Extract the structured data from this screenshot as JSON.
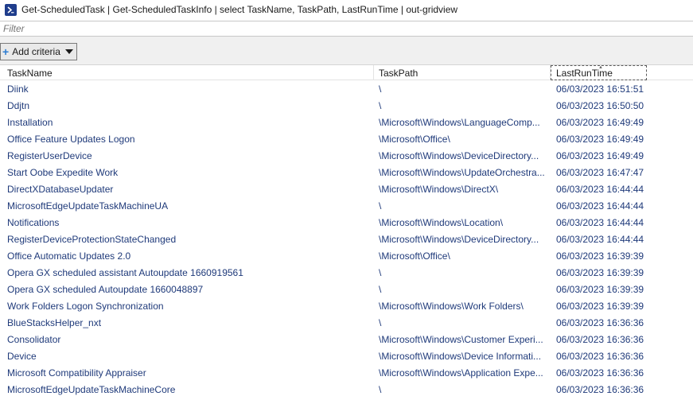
{
  "window": {
    "title": "Get-ScheduledTask | Get-ScheduledTaskInfo | select TaskName, TaskPath, LastRunTime | out-gridview",
    "icon": "powershell-icon"
  },
  "filter": {
    "placeholder": "Filter",
    "value": ""
  },
  "toolbar": {
    "add_criteria_label": "Add criteria"
  },
  "columns": {
    "name": "TaskName",
    "path": "TaskPath",
    "time": "LastRunTime"
  },
  "rows": [
    {
      "name": "Diink",
      "path": "\\",
      "time": "06/03/2023 16:51:51"
    },
    {
      "name": "Ddjtn",
      "path": "\\",
      "time": "06/03/2023 16:50:50"
    },
    {
      "name": "Installation",
      "path": "\\Microsoft\\Windows\\LanguageComp...",
      "time": "06/03/2023 16:49:49"
    },
    {
      "name": "Office Feature Updates Logon",
      "path": "\\Microsoft\\Office\\",
      "time": "06/03/2023 16:49:49"
    },
    {
      "name": "RegisterUserDevice",
      "path": "\\Microsoft\\Windows\\DeviceDirectory...",
      "time": "06/03/2023 16:49:49"
    },
    {
      "name": "Start Oobe Expedite Work",
      "path": "\\Microsoft\\Windows\\UpdateOrchestra...",
      "time": "06/03/2023 16:47:47"
    },
    {
      "name": "DirectXDatabaseUpdater",
      "path": "\\Microsoft\\Windows\\DirectX\\",
      "time": "06/03/2023 16:44:44"
    },
    {
      "name": "MicrosoftEdgeUpdateTaskMachineUA",
      "path": "\\",
      "time": "06/03/2023 16:44:44"
    },
    {
      "name": "Notifications",
      "path": "\\Microsoft\\Windows\\Location\\",
      "time": "06/03/2023 16:44:44"
    },
    {
      "name": "RegisterDeviceProtectionStateChanged",
      "path": "\\Microsoft\\Windows\\DeviceDirectory...",
      "time": "06/03/2023 16:44:44"
    },
    {
      "name": "Office Automatic Updates 2.0",
      "path": "\\Microsoft\\Office\\",
      "time": "06/03/2023 16:39:39"
    },
    {
      "name": "Opera GX scheduled assistant Autoupdate 1660919561",
      "path": "\\",
      "time": "06/03/2023 16:39:39"
    },
    {
      "name": "Opera GX scheduled Autoupdate 1660048897",
      "path": "\\",
      "time": "06/03/2023 16:39:39"
    },
    {
      "name": "Work Folders Logon Synchronization",
      "path": "\\Microsoft\\Windows\\Work Folders\\",
      "time": "06/03/2023 16:39:39"
    },
    {
      "name": "BlueStacksHelper_nxt",
      "path": "\\",
      "time": "06/03/2023 16:36:36"
    },
    {
      "name": "Consolidator",
      "path": "\\Microsoft\\Windows\\Customer Experi...",
      "time": "06/03/2023 16:36:36"
    },
    {
      "name": "Device",
      "path": "\\Microsoft\\Windows\\Device Informati...",
      "time": "06/03/2023 16:36:36"
    },
    {
      "name": "Microsoft Compatibility Appraiser",
      "path": "\\Microsoft\\Windows\\Application Expe...",
      "time": "06/03/2023 16:36:36"
    },
    {
      "name": "MicrosoftEdgeUpdateTaskMachineCore",
      "path": "\\",
      "time": "06/03/2023 16:36:36"
    }
  ]
}
